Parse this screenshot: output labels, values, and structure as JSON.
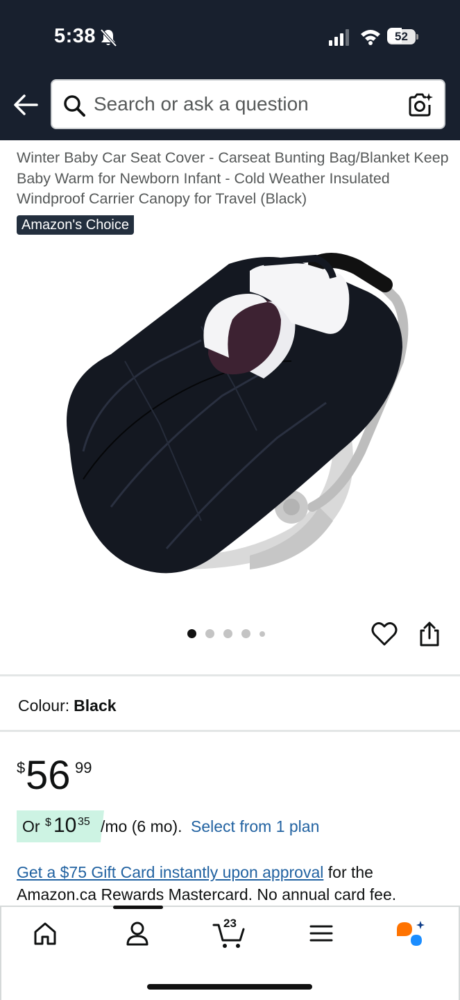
{
  "status_bar": {
    "time": "5:38",
    "battery": "52",
    "battery_level": 0.52
  },
  "header": {
    "search_placeholder": "Search or ask a question"
  },
  "product": {
    "title": "Winter Baby Car Seat Cover - Carseat Bunting Bag/Blanket Keep Baby Warm for Newborn Infant - Cold Weather Insulated Windproof Carrier Canopy for Travel (Black)",
    "badge": "Amazon's Choice",
    "image_count": 5,
    "active_image": 1
  },
  "colour": {
    "label": "Colour:",
    "value": "Black"
  },
  "price": {
    "symbol": "$",
    "whole": "56",
    "fraction": "99"
  },
  "installment": {
    "prefix": "Or",
    "symbol": "$",
    "whole": "10",
    "fraction": "35",
    "term": "/mo (6 mo).",
    "link": "Select from 1 plan"
  },
  "gift_card": {
    "link": "Get a $75 Gift Card instantly upon approval",
    "text": " for the Amazon.ca Rewards Mastercard. No annual card fee."
  },
  "bottom_nav": {
    "cart_count": "23",
    "items": [
      "home-icon",
      "account-icon",
      "cart-icon",
      "menu-icon",
      "rufus-icon"
    ]
  },
  "colors": {
    "header_bg": "#18202e",
    "link": "#2162a1",
    "installment_bg": "#cdf3e3",
    "badge_bg": "#232f3e"
  }
}
